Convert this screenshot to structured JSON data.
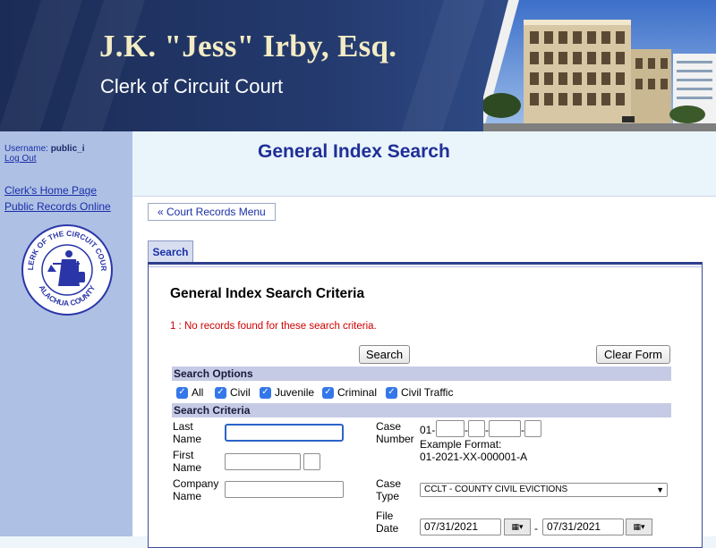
{
  "header": {
    "title": "J.K. \"Jess\" Irby, Esq.",
    "subtitle": "Clerk of Circuit Court"
  },
  "sidebar": {
    "username_label": "Username:",
    "username_value": "public_i",
    "logout": "Log Out",
    "links": [
      "Clerk's Home Page",
      "Public Records Online"
    ],
    "seal_text": "CLERK OF THE CIRCUIT COURT",
    "seal_bottom": "ALACHUA COUNTY"
  },
  "main": {
    "page_title": "General Index Search",
    "menu_button": "« Court Records Menu",
    "tab": "Search",
    "criteria_title": "General Index Search Criteria",
    "error_message": "1 : No records found for these search criteria.",
    "search_button": "Search",
    "clear_button": "Clear Form"
  },
  "search_options": {
    "header": "Search Options",
    "checkboxes": [
      {
        "label": "All",
        "checked": true
      },
      {
        "label": "Civil",
        "checked": true
      },
      {
        "label": "Juvenile",
        "checked": true
      },
      {
        "label": "Criminal",
        "checked": true
      },
      {
        "label": "Civil Traffic",
        "checked": true
      }
    ]
  },
  "search_criteria": {
    "header": "Search Criteria",
    "last_name_label_1": "Last",
    "last_name_label_2": "Name",
    "last_name_value": "",
    "first_name_label_1": "First",
    "first_name_label_2": "Name",
    "first_name_value": "",
    "middle_initial_value": "",
    "company_label_1": "Company",
    "company_label_2": "Name",
    "company_value": "",
    "case_number_label_1": "Case",
    "case_number_label_2": "Number",
    "case_prefix": "01-",
    "example_label": "Example Format:",
    "example_value": "01-2021-XX-000001-A",
    "case_type_label_1": "Case",
    "case_type_label_2": "Type",
    "case_type_value": "CCLT - COUNTY CIVIL EVICTIONS",
    "file_date_label_1": "File",
    "file_date_label_2": "Date",
    "date_from": "07/31/2021",
    "date_to": "07/31/2021",
    "date_separator": "-"
  },
  "colors": {
    "header_bg": "#1b2c56",
    "sidebar_bg": "#aec0e4",
    "title_blue": "#1f2f97",
    "section_bar": "#c6cbe5",
    "error_red": "#d00000",
    "checkbox_blue": "#3477e8"
  }
}
